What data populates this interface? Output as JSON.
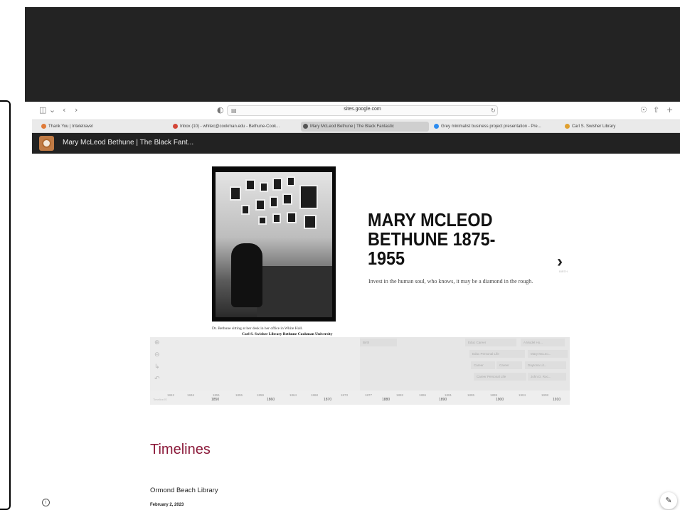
{
  "browser": {
    "url": "sites.google.com",
    "tabs": [
      {
        "label": "Thank You | Inteletravel",
        "favicon_color": "#e07b39"
      },
      {
        "label": "Inbox (10) - whitec@cookman.edu - Bethune-Cook...",
        "favicon_color": "#d44638"
      },
      {
        "label": "Mary McLeod Bethune | The Black Fantastic",
        "favicon_color": "#555555",
        "active": true
      },
      {
        "label": "Grey minimalist business project presentation - Pre...",
        "favicon_color": "#2d8cf0"
      },
      {
        "label": "Carl S. Swisher Library",
        "favicon_color": "#e0a030"
      }
    ],
    "icons": {
      "sidebar": "sidebar-icon",
      "back": "back-arrow-icon",
      "forward": "forward-arrow-icon",
      "privacy": "privacy-shield-icon",
      "reload": "reload-icon",
      "download": "download-icon",
      "share": "share-icon",
      "new_tab": "plus-icon"
    }
  },
  "site": {
    "title": "Mary McLeod Bethune | The Black Fant..."
  },
  "hero": {
    "caption_line1": "Dr. Bethune sitting at her desk in her office in White Hall.",
    "caption_line2": "Carl S. Swisher Library Bethune Cookman University",
    "title": "MARY MCLEOD BETHUNE 1875-1955",
    "quote": "Invest in the human soul, who knows, it may be a diamond in the rough.",
    "next_label": "BIRTH"
  },
  "timeline": {
    "events": [
      {
        "label": "Birth"
      },
      {
        "label": "Educ Career"
      },
      {
        "label": "A Model Ho..."
      },
      {
        "label": "Educ Personal Life"
      },
      {
        "label": "Mary McLeo..."
      },
      {
        "label": "Career"
      },
      {
        "label": "Career"
      },
      {
        "label": "Daytona Lit..."
      },
      {
        "label": "Career Personal Life"
      },
      {
        "label": "John D. Roc..."
      }
    ],
    "minor_ticks": [
      "1842",
      "1846",
      "1851",
      "1855",
      "1859",
      "1864",
      "1868",
      "1873",
      "1877",
      "1882",
      "1886",
      "1891",
      "1895",
      "1899",
      "1904",
      "1908"
    ],
    "major_ticks": [
      "1850",
      "1860",
      "1870",
      "1880",
      "1890",
      "1900",
      "1910"
    ],
    "credit": "TimelineJS"
  },
  "section": {
    "title": "Timelines",
    "entry_title": "Ormond Beach Library",
    "entry_date": "February 2, 2023"
  },
  "accent_color": "#8b1a3a"
}
